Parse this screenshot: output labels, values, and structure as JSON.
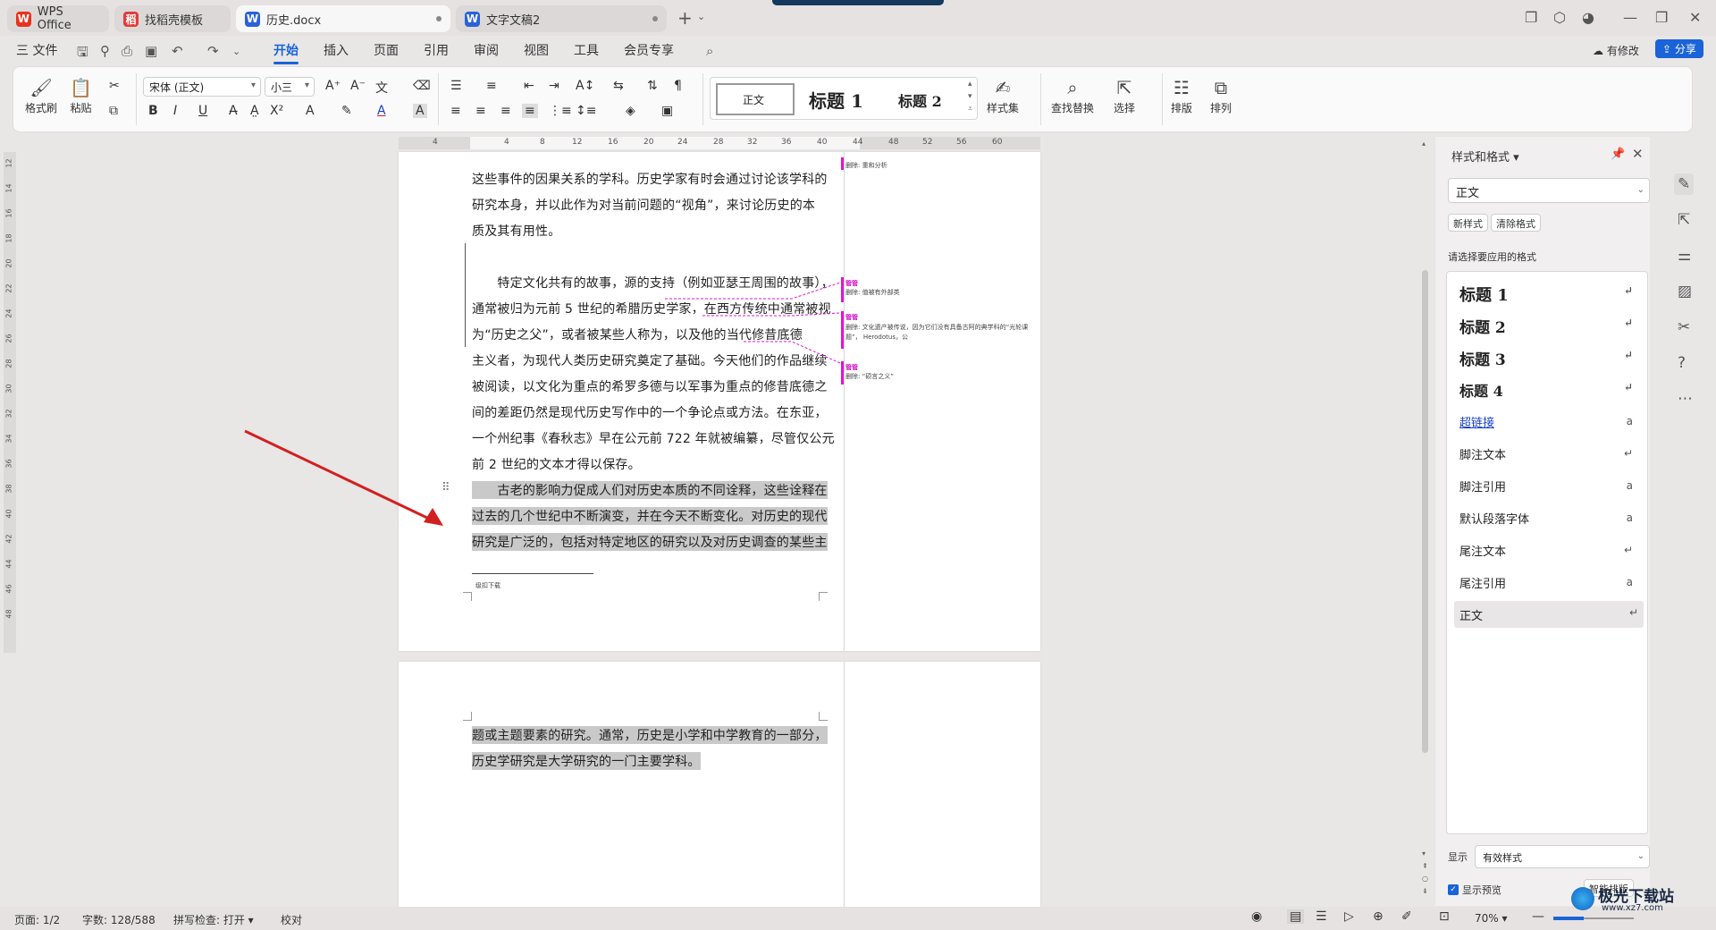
{
  "tabs": [
    {
      "label": "WPS Office",
      "logo": "W",
      "color": "#e8321d"
    },
    {
      "label": "找稻壳模板",
      "logo": "稻",
      "color": "#e23b3b"
    },
    {
      "label": "历史.docx",
      "logo": "W",
      "color": "#2a62d8"
    },
    {
      "label": "文字文稿2",
      "logo": "W",
      "color": "#2a62d8"
    }
  ],
  "menu": {
    "file": "三 文件",
    "items": [
      "开始",
      "插入",
      "页面",
      "引用",
      "审阅",
      "视图",
      "工具",
      "会员专享"
    ],
    "active": "开始",
    "modified": "有修改",
    "share": "分享"
  },
  "ribbon": {
    "format_painter": "格式刷",
    "paste": "粘贴",
    "font_name": "宋体 (正文)",
    "font_size": "小三",
    "styles": [
      "正文",
      "标题 1",
      "标题 2"
    ],
    "style_set": "样式集",
    "find_replace": "查找替换",
    "select": "选择",
    "layout": "排版",
    "arrange": "排列"
  },
  "ruler": {
    "h_ticks": [
      "4",
      "4",
      "8",
      "12",
      "16",
      "20",
      "24",
      "28",
      "32",
      "36",
      "40",
      "44",
      "48",
      "52",
      "56",
      "60"
    ],
    "v_ticks": [
      "12",
      "14",
      "16",
      "18",
      "20",
      "22",
      "24",
      "26",
      "28",
      "30",
      "32",
      "34",
      "36",
      "38",
      "40",
      "42",
      "44",
      "46",
      "48"
    ]
  },
  "document": {
    "page1_lines": [
      "这些事件的因果关系的学科。历史学家有时会通过讨论该学科的",
      "研究本身，并以此作为对当前问题的“视角”，来讨论历史的本",
      "质及其有用性。",
      "",
      "　　特定文化共有的故事，源的支持（例如亚瑟王周围的故事），",
      "通常被归为元前 5 世纪的希腊历史学家，在西方传统中通常被视",
      "为“历史之父”，或者被某些人称为，以及他的当代修昔底德",
      "主义者，为现代人类历史研究奠定了基础。今天他们的作品继续",
      "被阅读，以文化为重点的希罗多德与以军事为重点的修昔底德之",
      "间的差距仍然是现代历史写作中的一个争论点或方法。在东亚，",
      "一个州纪事《春秋志》早在公元前 722 年就被编纂，尽管仅公元",
      "前 2 世纪的文本才得以保存。"
    ],
    "page1_highlighted": [
      "　　古老的影响力促成人们对历史本质的不同诠释，这些诠释在",
      "过去的几个世纪中不断演变，并在今天不断变化。对历史的现代",
      "研究是广泛的，包括对特定地区的研究以及对历史调查的某些主"
    ],
    "footnote": "级扣下载",
    "page2_highlighted": [
      "题或主题要素的研究。通常，历史是小学和中学教育的一部分，",
      "历史学研究是大学研究的一门主要学科。"
    ]
  },
  "comments": [
    {
      "author": "",
      "text": "删除: 重和分析"
    },
    {
      "author": "管管",
      "text": "删除: 值被有外部类"
    },
    {
      "author": "管管",
      "text": "删除: 文化遗产被传说，因为它们没有具备古阿的典学科的“光轮课题”， Herodotus，公"
    },
    {
      "author": "管管",
      "text": "删除: “硕言之义”"
    }
  ],
  "panel": {
    "title": "样式和格式",
    "current_style": "正文",
    "new_style": "新样式",
    "clear_format": "清除格式",
    "prompt": "请选择要应用的格式",
    "styles": [
      {
        "name": "标题  1",
        "mark": "↵"
      },
      {
        "name": "标题  2",
        "mark": "↵"
      },
      {
        "name": "标题  3",
        "mark": "↵"
      },
      {
        "name": "标题  4",
        "mark": "↵"
      },
      {
        "name": "超链接",
        "mark": "a"
      },
      {
        "name": "脚注文本",
        "mark": "↵"
      },
      {
        "name": "脚注引用",
        "mark": "a"
      },
      {
        "name": "默认段落字体",
        "mark": "a"
      },
      {
        "name": "尾注文本",
        "mark": "↵"
      },
      {
        "name": "尾注引用",
        "mark": "a"
      },
      {
        "name": "正文",
        "mark": "↵"
      }
    ],
    "show_label": "显示",
    "show_value": "有效样式",
    "preview_label": "显示预览",
    "smart_layout": "智能排版"
  },
  "status": {
    "page": "页面: 1/2",
    "words": "字数: 128/588",
    "spell": "拼写检查: 打开",
    "proof": "校对",
    "zoom": "70%"
  },
  "watermark": {
    "line1": "极光下载站",
    "line2": "www.xz7.com"
  },
  "colors": {
    "accent": "#1a63d8",
    "comment": "#e015d3",
    "arrow": "#d22020"
  }
}
